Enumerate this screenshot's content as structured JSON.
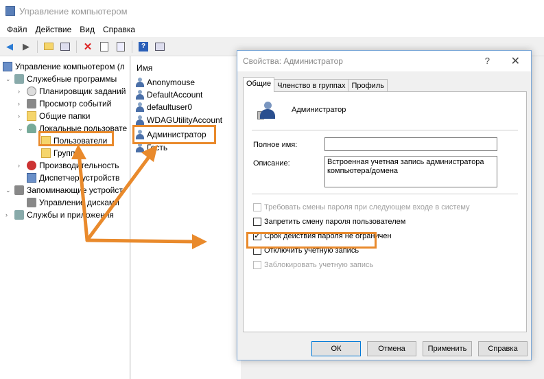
{
  "window": {
    "title": "Управление компьютером"
  },
  "menu": [
    "Файл",
    "Действие",
    "Вид",
    "Справка"
  ],
  "toolbar": {
    "icons": [
      "back-arrow-icon",
      "forward-arrow-icon",
      "folder-up-icon",
      "console-tree-icon",
      "delete-icon",
      "properties-icon",
      "export-icon",
      "help-icon",
      "view-icon"
    ]
  },
  "tree": {
    "root": "Управление компьютером (л",
    "services": "Служебные программы",
    "scheduler": "Планировщик заданий",
    "events": "Просмотр событий",
    "shared": "Общие папки",
    "localusers": "Локальные пользовате",
    "users": "Пользователи",
    "groups": "Группы",
    "performance": "Производительность",
    "devmgr": "Диспетчер устройств",
    "storage": "Запоминающие устройст",
    "diskmgmt": "Управление дисками",
    "svcapps": "Службы и приложения"
  },
  "list": {
    "header": "Имя",
    "items": [
      "Anonymouse",
      "DefaultAccount",
      "defaultuser0",
      "WDAGUtilityAccount",
      "Администратор",
      "Гость"
    ]
  },
  "dialog": {
    "title": "Свойства: Администратор",
    "help_glyph": "?",
    "close_glyph": "✕",
    "tabs": [
      "Общие",
      "Членство в группах",
      "Профиль"
    ],
    "username": "Администратор",
    "fullname_label": "Полное имя:",
    "fullname_value": "",
    "description_label": "Описание:",
    "description_value": "Встроенная учетная запись администратора компьютера/домена",
    "checkboxes": [
      {
        "label": "Требовать смены пароля при следующем входе в систему",
        "checked": false,
        "enabled": false
      },
      {
        "label": "Запретить смену пароля пользователем",
        "checked": false,
        "enabled": true
      },
      {
        "label": "Срок действия пароля не ограничен",
        "checked": true,
        "enabled": true
      },
      {
        "label": "Отключить учетную запись",
        "checked": false,
        "enabled": true
      },
      {
        "label": "Заблокировать учетную запись",
        "checked": false,
        "enabled": false
      }
    ],
    "buttons": {
      "ok": "ОК",
      "cancel": "Отмена",
      "apply": "Применить",
      "help": "Справка"
    }
  },
  "colors": {
    "highlight": "#e98a2c",
    "dialog_border": "#7aa7d8"
  }
}
